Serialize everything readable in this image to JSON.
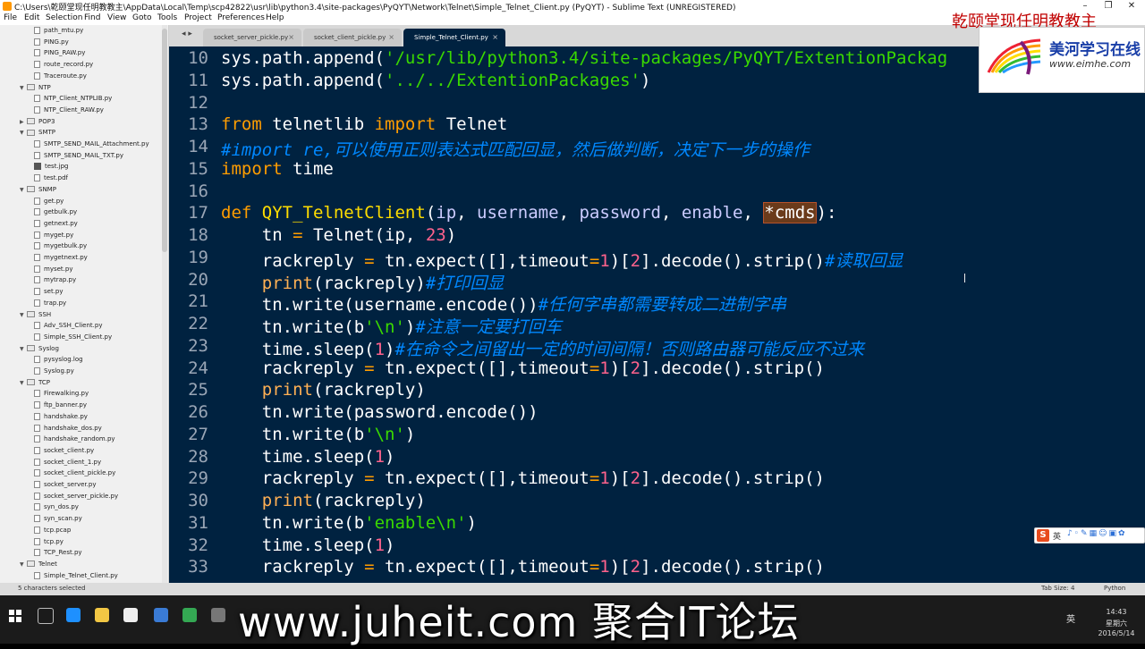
{
  "window": {
    "title": "C:\\Users\\乾颐堂现任明教教主\\AppData\\Local\\Temp\\scp42822\\usr\\lib\\python3.4\\site-packages\\PyQYT\\Network\\Telnet\\Simple_Telnet_Client.py (PyQYT) - Sublime Text (UNREGISTERED)"
  },
  "menu": [
    "File",
    "Edit",
    "Selection",
    "Find",
    "View",
    "Goto",
    "Tools",
    "Project",
    "Preferences",
    "Help"
  ],
  "sidebar": {
    "rows": [
      {
        "label": "path_mtu.py",
        "kind": "file",
        "indent": 3
      },
      {
        "label": "PING.py",
        "kind": "file",
        "indent": 3
      },
      {
        "label": "PING_RAW.py",
        "kind": "file",
        "indent": 3
      },
      {
        "label": "route_record.py",
        "kind": "file",
        "indent": 3
      },
      {
        "label": "Traceroute.py",
        "kind": "file",
        "indent": 3
      },
      {
        "label": "NTP",
        "kind": "folder-open",
        "indent": 2
      },
      {
        "label": "NTP_Client_NTPLIB.py",
        "kind": "file",
        "indent": 3
      },
      {
        "label": "NTP_Client_RAW.py",
        "kind": "file",
        "indent": 3
      },
      {
        "label": "POP3",
        "kind": "folder",
        "indent": 2
      },
      {
        "label": "SMTP",
        "kind": "folder-open",
        "indent": 2
      },
      {
        "label": "SMTP_SEND_MAIL_Attachment.py",
        "kind": "file",
        "indent": 3
      },
      {
        "label": "SMTP_SEND_MAIL_TXT.py",
        "kind": "file",
        "indent": 3
      },
      {
        "label": "test.jpg",
        "kind": "image",
        "indent": 3
      },
      {
        "label": "test.pdf",
        "kind": "file",
        "indent": 3
      },
      {
        "label": "SNMP",
        "kind": "folder-open",
        "indent": 2
      },
      {
        "label": "get.py",
        "kind": "file",
        "indent": 3
      },
      {
        "label": "getbulk.py",
        "kind": "file",
        "indent": 3
      },
      {
        "label": "getnext.py",
        "kind": "file",
        "indent": 3
      },
      {
        "label": "myget.py",
        "kind": "file",
        "indent": 3
      },
      {
        "label": "mygetbulk.py",
        "kind": "file",
        "indent": 3
      },
      {
        "label": "mygetnext.py",
        "kind": "file",
        "indent": 3
      },
      {
        "label": "myset.py",
        "kind": "file",
        "indent": 3
      },
      {
        "label": "mytrap.py",
        "kind": "file",
        "indent": 3
      },
      {
        "label": "set.py",
        "kind": "file",
        "indent": 3
      },
      {
        "label": "trap.py",
        "kind": "file",
        "indent": 3
      },
      {
        "label": "SSH",
        "kind": "folder-open",
        "indent": 2
      },
      {
        "label": "Adv_SSH_Client.py",
        "kind": "file",
        "indent": 3
      },
      {
        "label": "Simple_SSH_Client.py",
        "kind": "file",
        "indent": 3
      },
      {
        "label": "Syslog",
        "kind": "folder-open",
        "indent": 2
      },
      {
        "label": "pysyslog.log",
        "kind": "file",
        "indent": 3
      },
      {
        "label": "Syslog.py",
        "kind": "file",
        "indent": 3
      },
      {
        "label": "TCP",
        "kind": "folder-open",
        "indent": 2
      },
      {
        "label": "Firewalking.py",
        "kind": "file",
        "indent": 3
      },
      {
        "label": "ftp_banner.py",
        "kind": "file",
        "indent": 3
      },
      {
        "label": "handshake.py",
        "kind": "file",
        "indent": 3
      },
      {
        "label": "handshake_dos.py",
        "kind": "file",
        "indent": 3
      },
      {
        "label": "handshake_random.py",
        "kind": "file",
        "indent": 3
      },
      {
        "label": "socket_client.py",
        "kind": "file",
        "indent": 3
      },
      {
        "label": "socket_client_1.py",
        "kind": "file",
        "indent": 3
      },
      {
        "label": "socket_client_pickle.py",
        "kind": "file",
        "indent": 3
      },
      {
        "label": "socket_server.py",
        "kind": "file",
        "indent": 3
      },
      {
        "label": "socket_server_pickle.py",
        "kind": "file",
        "indent": 3
      },
      {
        "label": "syn_dos.py",
        "kind": "file",
        "indent": 3
      },
      {
        "label": "syn_scan.py",
        "kind": "file",
        "indent": 3
      },
      {
        "label": "tcp.pcap",
        "kind": "file",
        "indent": 3
      },
      {
        "label": "tcp.py",
        "kind": "file",
        "indent": 3
      },
      {
        "label": "TCP_Rest.py",
        "kind": "file",
        "indent": 3
      },
      {
        "label": "Telnet",
        "kind": "folder-open",
        "indent": 2
      },
      {
        "label": "Simple_Telnet_Client.py",
        "kind": "file",
        "indent": 3
      }
    ]
  },
  "tabs": [
    {
      "label": "socket_server_pickle.py",
      "active": false
    },
    {
      "label": "socket_client_pickle.py",
      "active": false
    },
    {
      "label": "Simple_Telnet_Client.py",
      "active": true
    }
  ],
  "editor": {
    "lines": [
      {
        "n": "10",
        "tokens": [
          [
            "",
            "sys.path.append("
          ],
          [
            "st",
            "'/usr/lib/python3.4/site-packages/PyQYT/ExtentionPackag"
          ]
        ]
      },
      {
        "n": "11",
        "tokens": [
          [
            "",
            "sys.path.append("
          ],
          [
            "st",
            "'../../ExtentionPackages'"
          ],
          [
            "",
            ")"
          ]
        ]
      },
      {
        "n": "12",
        "tokens": []
      },
      {
        "n": "13",
        "tokens": [
          [
            "kw",
            "from"
          ],
          [
            "",
            " telnetlib "
          ],
          [
            "kw",
            "import"
          ],
          [
            "",
            " Telnet"
          ]
        ]
      },
      {
        "n": "14",
        "tokens": [
          [
            "cm",
            "#import re,可以使用正则表达式匹配回显，然后做判断，决定下一步的操作"
          ]
        ]
      },
      {
        "n": "15",
        "tokens": [
          [
            "kw",
            "import"
          ],
          [
            "",
            " time"
          ]
        ]
      },
      {
        "n": "16",
        "tokens": []
      },
      {
        "n": "17",
        "tokens": [
          [
            "kw",
            "def"
          ],
          [
            "",
            " "
          ],
          [
            "fn",
            "QYT_TelnetClient"
          ],
          [
            "",
            "("
          ],
          [
            "pr",
            "ip"
          ],
          [
            "",
            ", "
          ],
          [
            "pr",
            "username"
          ],
          [
            "",
            ", "
          ],
          [
            "pr",
            "password"
          ],
          [
            "",
            ", "
          ],
          [
            "pr",
            "enable"
          ],
          [
            "",
            ", "
          ],
          [
            "sel",
            "*cmds"
          ],
          [
            "",
            "):"
          ]
        ]
      },
      {
        "n": "18",
        "tokens": [
          [
            "",
            "    tn "
          ],
          [
            "op",
            "="
          ],
          [
            "",
            " Telnet(ip, "
          ],
          [
            "nu",
            "23"
          ],
          [
            "",
            ")"
          ]
        ]
      },
      {
        "n": "19",
        "tokens": [
          [
            "",
            "    rackreply "
          ],
          [
            "op",
            "="
          ],
          [
            "",
            " tn.expect([],timeout"
          ],
          [
            "op",
            "="
          ],
          [
            "nu",
            "1"
          ],
          [
            "",
            ")["
          ],
          [
            "nu",
            "2"
          ],
          [
            "",
            "].decode().strip()"
          ],
          [
            "cm",
            "#读取回显"
          ]
        ]
      },
      {
        "n": "20",
        "tokens": [
          [
            "",
            "    "
          ],
          [
            "bi",
            "print"
          ],
          [
            "",
            "(rackreply)"
          ],
          [
            "cm",
            "#打印回显"
          ]
        ]
      },
      {
        "n": "21",
        "tokens": [
          [
            "",
            "    tn.write(username.encode())"
          ],
          [
            "cm",
            "#任何字串都需要转成二进制字串"
          ]
        ]
      },
      {
        "n": "22",
        "tokens": [
          [
            "",
            "    tn.write(b"
          ],
          [
            "st",
            "'\\n'"
          ],
          [
            "",
            ")"
          ],
          [
            "cm",
            "#注意一定要打回车"
          ]
        ]
      },
      {
        "n": "23",
        "tokens": [
          [
            "",
            "    time.sleep("
          ],
          [
            "nu",
            "1"
          ],
          [
            "",
            ")"
          ],
          [
            "cm",
            "#在命令之间留出一定的时间间隔！否则路由器可能反应不过来"
          ]
        ]
      },
      {
        "n": "24",
        "tokens": [
          [
            "",
            "    rackreply "
          ],
          [
            "op",
            "="
          ],
          [
            "",
            " tn.expect([],timeout"
          ],
          [
            "op",
            "="
          ],
          [
            "nu",
            "1"
          ],
          [
            "",
            ")["
          ],
          [
            "nu",
            "2"
          ],
          [
            "",
            "].decode().strip()"
          ]
        ]
      },
      {
        "n": "25",
        "tokens": [
          [
            "",
            "    "
          ],
          [
            "bi",
            "print"
          ],
          [
            "",
            "(rackreply)"
          ]
        ]
      },
      {
        "n": "26",
        "tokens": [
          [
            "",
            "    tn.write(password.encode())"
          ]
        ]
      },
      {
        "n": "27",
        "tokens": [
          [
            "",
            "    tn.write(b"
          ],
          [
            "st",
            "'\\n'"
          ],
          [
            "",
            ")"
          ]
        ]
      },
      {
        "n": "28",
        "tokens": [
          [
            "",
            "    time.sleep("
          ],
          [
            "nu",
            "1"
          ],
          [
            "",
            ")"
          ]
        ]
      },
      {
        "n": "29",
        "tokens": [
          [
            "",
            "    rackreply "
          ],
          [
            "op",
            "="
          ],
          [
            "",
            " tn.expect([],timeout"
          ],
          [
            "op",
            "="
          ],
          [
            "nu",
            "1"
          ],
          [
            "",
            ")["
          ],
          [
            "nu",
            "2"
          ],
          [
            "",
            "].decode().strip()"
          ]
        ]
      },
      {
        "n": "30",
        "tokens": [
          [
            "",
            "    "
          ],
          [
            "bi",
            "print"
          ],
          [
            "",
            "(rackreply)"
          ]
        ]
      },
      {
        "n": "31",
        "tokens": [
          [
            "",
            "    tn.write(b"
          ],
          [
            "st",
            "'enable\\n'"
          ],
          [
            "",
            ")"
          ]
        ]
      },
      {
        "n": "32",
        "tokens": [
          [
            "",
            "    time.sleep("
          ],
          [
            "nu",
            "1"
          ],
          [
            "",
            ")"
          ]
        ]
      },
      {
        "n": "33",
        "tokens": [
          [
            "",
            "    rackreply "
          ],
          [
            "op",
            "="
          ],
          [
            "",
            " tn.expect([],timeout"
          ],
          [
            "op",
            "="
          ],
          [
            "nu",
            "1"
          ],
          [
            "",
            ")["
          ],
          [
            "nu",
            "2"
          ],
          [
            "",
            "].decode().strip()"
          ]
        ]
      }
    ]
  },
  "status": {
    "selection": "5 characters selected",
    "tab_size": "Tab Size: 4",
    "syntax": "Python"
  },
  "taskbar": {
    "time": "14:43",
    "day": "星期六",
    "date": "2016/5/14",
    "ime": "英"
  },
  "overlays": {
    "watermark_top": "乾颐堂现任明教教主",
    "logo_cn": "美河学习在线",
    "logo_url": "www.eimhe.com",
    "ime_lang": "英",
    "ime_s": "S",
    "caption": "www.juheit.com 聚合IT论坛"
  },
  "colors": {
    "editor_bg": "#002240",
    "keyword": "#ff9d00",
    "string": "#3ad900",
    "number": "#ff628c",
    "comment": "#0088ff",
    "function": "#ffdd00"
  }
}
